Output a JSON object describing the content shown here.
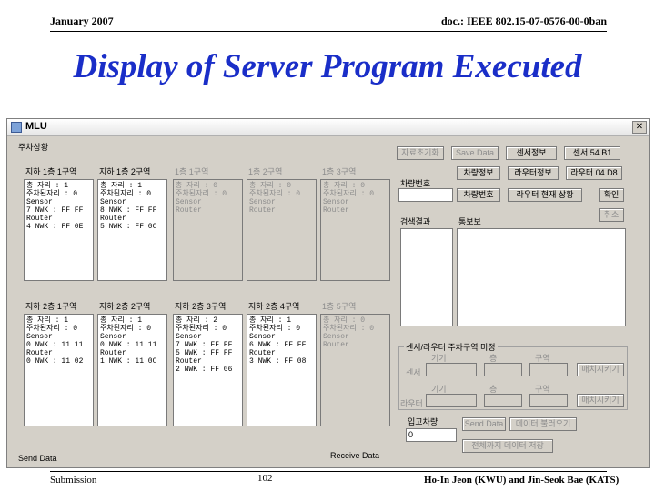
{
  "slide": {
    "date": "January 2007",
    "doc_id": "doc.: IEEE 802.15-07-0576-00-0ban",
    "title": "Display of Server Program Executed",
    "footer_left": "Submission",
    "page_number": "102",
    "footer_right": "Ho-In Jeon (KWU) and Jin-Seok Bae (KATS)"
  },
  "window": {
    "title": "MLU",
    "close_glyph": "✕",
    "group_label": "주차상황",
    "top_panels": [
      {
        "title": "지하 1층 1구역",
        "lines": [
          "총 자리 : 1",
          "주차된자리 : 0",
          "Sensor",
          "7 NWK : FF FF",
          "Router",
          "4 NWK : FF 0E"
        ],
        "disabled": false
      },
      {
        "title": "지하 1층 2구역",
        "lines": [
          "총 자리 : 1",
          "주차된자리 : 0",
          "Sensor",
          "8 NWK : FF FF",
          "Router",
          "5 NWK : FF 0C"
        ],
        "disabled": false
      },
      {
        "title": "1층 1구역",
        "lines": [
          "총 자리 : 0",
          "주차된자리 : 0",
          "Sensor",
          "Router"
        ],
        "disabled": true
      },
      {
        "title": "1층 2구역",
        "lines": [
          "총 자리 : 0",
          "주차된자리 : 0",
          "Sensor",
          "Router"
        ],
        "disabled": true
      },
      {
        "title": "1층 3구역",
        "lines": [
          "총 자리 : 0",
          "주차된자리 : 0",
          "Sensor",
          "Router"
        ],
        "disabled": true
      }
    ],
    "bottom_panels": [
      {
        "title": "지하 2층 1구역",
        "lines": [
          "총 자리 : 1",
          "주차된자리 : 0",
          "Sensor",
          "0 NWK : 11 11",
          "Router",
          "0 NWK : 11 02"
        ],
        "disabled": false
      },
      {
        "title": "지하 2층 2구역",
        "lines": [
          "총 자리 : 1",
          "주차된자리 : 0",
          "Sensor",
          "0 NWK : 11 11",
          "Router",
          "1 NWK : 11 0C"
        ],
        "disabled": false
      },
      {
        "title": "지하 2층 3구역",
        "lines": [
          "총 자리 : 2",
          "주차된자리 : 0",
          "Sensor",
          "7 NWK : FF FF",
          "5 NWK : FF FF",
          "Router",
          "2 NWK : FF 06"
        ],
        "disabled": false
      },
      {
        "title": "지하 2층 4구역",
        "lines": [
          "총 자리 : 1",
          "주차된자리 : 0",
          "Sensor",
          "6 NWK : FF FF",
          "Router",
          "3 NWK : FF 08"
        ],
        "disabled": false
      },
      {
        "title": "1층 5구역",
        "lines": [
          "총 자리 : 0",
          "주차된자리 : 0",
          "Sensor",
          "Router"
        ],
        "disabled": true
      }
    ],
    "send_data_label": "Send Data",
    "receive_data_label": "Receive Data",
    "buttons": {
      "init": "자료초기화",
      "save_data": "Save Data",
      "sensor_info": "센서정보",
      "sensor_54": "센서 54 B1",
      "vehicle_info": "차량정보",
      "router_info": "라우터정보",
      "router_04": "라우터 04 D8",
      "car_num": "차량번호",
      "router_status": "라우터 현재 상황",
      "confirm": "확인",
      "cancel": "취소",
      "match1": "매치시키기",
      "match2": "매치시키기",
      "send_data_btn": "Send Data",
      "load_data": "데이터 불러오기",
      "save_all": "전체까지 데이터 저장"
    },
    "car_number_label": "차량번호",
    "search_result_label": "검색결과",
    "notice_label": "통보보",
    "sensor_router_group": "센서/라우터 주차구역 미정",
    "field_labels": {
      "gigi1": "기기",
      "cheung1": "층",
      "guyeok1": "구역",
      "sensor": "센서",
      "gigi2": "기기",
      "cheung2": "층",
      "guyeok2": "구역",
      "router": "라우터"
    },
    "input_label": "입고차량",
    "input_value": "0"
  }
}
